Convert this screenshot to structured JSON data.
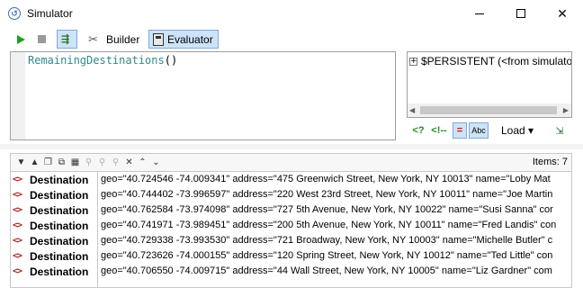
{
  "window": {
    "title": "Simulator",
    "app_icon_glyph": "↺"
  },
  "toolbar": {
    "builder_label": "Builder",
    "evaluator_label": "Evaluator",
    "step_glyph": "⇶"
  },
  "editor": {
    "func_name": "RemainingDestinations",
    "parens": "()"
  },
  "variables": {
    "expander": "+",
    "entry": "$PERSISTENT (<from simulato"
  },
  "vars_toolbar": {
    "q_label": "<?",
    "arrow_label": "<!--",
    "eq_label": "=",
    "abc_label": "Abc",
    "load_label": "Load ▾"
  },
  "results": {
    "items_count": "Items: 7",
    "tag_icon_text": "<>",
    "rows": [
      {
        "tag": "Destination",
        "attrs": "geo=\"40.724546 -74.009341\" address=\"475 Greenwich Street, New York, NY 10013\" name=\"Loby Mat"
      },
      {
        "tag": "Destination",
        "attrs": "geo=\"40.744402 -73.996597\" address=\"220 West 23rd Street, New York, NY 10011\" name=\"Joe Martin"
      },
      {
        "tag": "Destination",
        "attrs": "geo=\"40.762584 -73.974098\" address=\"727 5th Avenue, New York, NY 10022\" name=\"Susi Sanna\" cor"
      },
      {
        "tag": "Destination",
        "attrs": "geo=\"40.741971 -73.989451\" address=\"200 5th Avenue, New York, NY 10011\" name=\"Fred Landis\" con"
      },
      {
        "tag": "Destination",
        "attrs": "geo=\"40.729338 -73.993530\" address=\"721 Broadway, New York, NY 10003\" name=\"Michelle Butler\" c"
      },
      {
        "tag": "Destination",
        "attrs": "geo=\"40.723626 -74.000155\" address=\"120 Spring Street, New York, NY 10012\" name=\"Ted Little\" con"
      },
      {
        "tag": "Destination",
        "attrs": "geo=\"40.706550 -74.009715\" address=\"44 Wall Street, New York, NY 10005\" name=\"Liz Gardner\" com"
      }
    ]
  }
}
